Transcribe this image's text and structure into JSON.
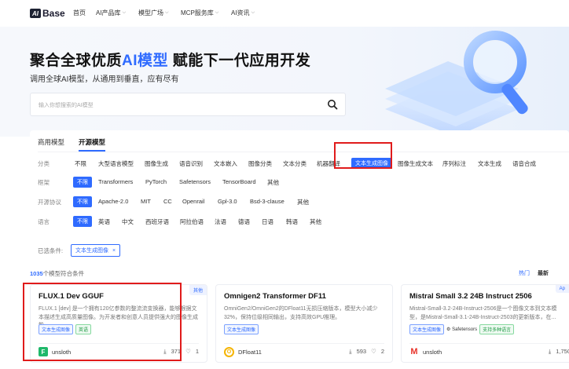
{
  "nav": {
    "logo_text": "Base",
    "logo_mark": "AI",
    "items": [
      {
        "label": "首页",
        "has_menu": false
      },
      {
        "label": "AI产品库",
        "has_menu": true
      },
      {
        "label": "模型广场",
        "has_menu": true
      },
      {
        "label": "MCP服务库",
        "has_menu": true
      },
      {
        "label": "AI资讯",
        "has_menu": true
      }
    ]
  },
  "hero": {
    "title_prefix": "聚合全球优质",
    "title_ai": "AI模型",
    "title_suffix": " 赋能下一代应用开发",
    "subtitle": "调用全球AI模型，从通用到垂直，应有尽有",
    "search_placeholder": "输入你想搜索的AI模型"
  },
  "filters": {
    "tabs": [
      {
        "label": "商用模型",
        "active": false
      },
      {
        "label": "开源模型",
        "active": true
      }
    ],
    "rows": [
      {
        "label": "分类",
        "options": [
          "不限",
          "大型语言模型",
          "图像生成",
          "语音识别",
          "文本嵌入",
          "图像分类",
          "文本分类",
          "机器翻译",
          "文本生成图像",
          "图像生成文本",
          "序列标注",
          "文本生成",
          "语音合成"
        ],
        "selected": "文本生成图像"
      },
      {
        "label": "框架",
        "options": [
          "不限",
          "Transformers",
          "PyTorch",
          "Safetensors",
          "TensorBoard",
          "其他"
        ],
        "selected": "不限"
      },
      {
        "label": "开源协议",
        "options": [
          "不限",
          "Apache-2.0",
          "MIT",
          "CC",
          "Openrail",
          "Gpl-3.0",
          "Bsd-3-clause",
          "其他"
        ],
        "selected": "不限"
      },
      {
        "label": "语言",
        "options": [
          "不限",
          "英语",
          "中文",
          "西班牙语",
          "阿拉伯语",
          "法语",
          "德语",
          "日语",
          "韩语",
          "其他"
        ],
        "selected": "不限"
      }
    ]
  },
  "selected_conditions": {
    "label": "已选条件:",
    "chip": "文本生成图像",
    "chip_close": "×"
  },
  "results": {
    "count": "1035",
    "count_suffix": "个模型符合条件",
    "sort_hot": "热门",
    "sort_new": "最新"
  },
  "cards": [
    {
      "title": "FLUX.1 Dev GGUF",
      "badge": "其他",
      "desc": "FLUX.1 [dev] 是一个拥有120亿参数的整流流变换器，能够根据文本描述生成高质量图像。为开发者和创意人员提供强大的图像生成能...",
      "tags": [
        {
          "kind": "blue",
          "text": "文本生成图像"
        },
        {
          "kind": "green",
          "text": "英语"
        }
      ],
      "author": "unsloth",
      "avatar_letter": "F",
      "avatar_color": "#1fb86a",
      "downloads": "371",
      "likes": "1"
    },
    {
      "title": "Omnigen2 Transformer DF11",
      "badge": "",
      "desc": "OmniGen2/OmniGen2的DFloat11无损压缩版本，模型大小减少32%，保持位级相同输出，支持高效GPU推理。",
      "tags": [
        {
          "kind": "blue",
          "text": "文本生成图像"
        }
      ],
      "author": "DFloat11",
      "avatar_letter": "O",
      "avatar_color": "#f5b400",
      "downloads": "593",
      "likes": "2"
    },
    {
      "title": "Mistral Small 3.2 24B Instruct 2506",
      "badge": "Ap",
      "desc": "Mistral-Small-3.2-24B-Instruct-2506是一个图像文本到文本模型，是Mistral-Small-3.1-24B-Instruct-2503的更新版本，在...",
      "tags": [
        {
          "kind": "blue",
          "text": "文本生成图像"
        },
        {
          "kind": "plain",
          "text": "Safetensors"
        },
        {
          "kind": "green",
          "text": "支持多种语言"
        }
      ],
      "author": "unsloth",
      "avatar_letter": "M",
      "avatar_color": "#e8332a",
      "downloads": "1,750",
      "likes": ""
    }
  ],
  "icons": {
    "download": "⤓",
    "like": "♡",
    "search": "search-icon"
  },
  "colors": {
    "accent": "#2f6bff",
    "annotation": "#e01b1b"
  }
}
